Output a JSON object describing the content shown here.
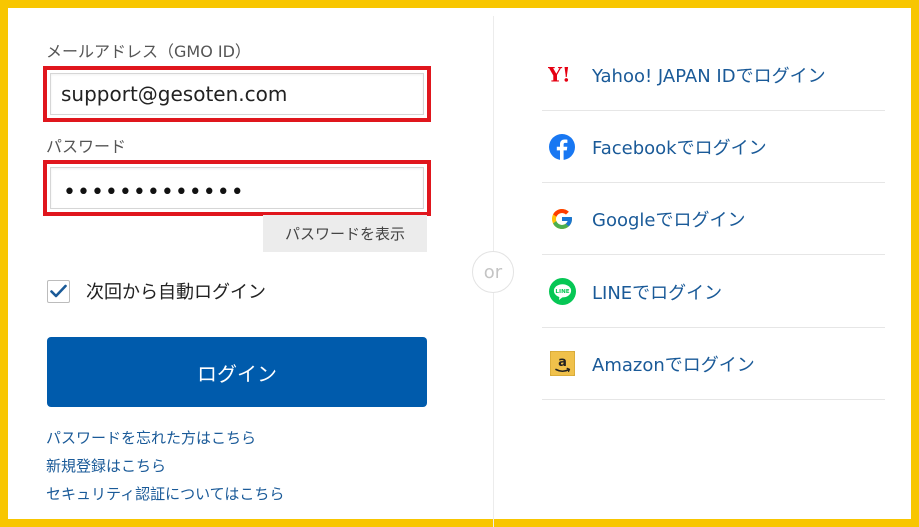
{
  "email": {
    "label": "メールアドレス（GMO ID）",
    "value": "support@gesoten.com"
  },
  "password": {
    "label": "パスワード",
    "masked_value": "•••••••••••••",
    "show_button": "パスワードを表示"
  },
  "remember": {
    "label": "次回から自動ログイン",
    "checked": true
  },
  "login_button": "ログイン",
  "links": {
    "forgot_password": "パスワードを忘れた方はこちら",
    "register": "新規登録はこちら",
    "security": "セキュリティ認証についてはこちら"
  },
  "separator": "or",
  "social": [
    {
      "icon": "yahoo-japan-icon",
      "label": "Yahoo! JAPAN IDでログイン"
    },
    {
      "icon": "facebook-icon",
      "label": "Facebookでログイン"
    },
    {
      "icon": "google-icon",
      "label": "Googleでログイン"
    },
    {
      "icon": "line-icon",
      "label": "LINEでログイン"
    },
    {
      "icon": "amazon-icon",
      "label": "Amazonでログイン"
    }
  ],
  "colors": {
    "frame": "#f8c600",
    "highlight": "#e0161d",
    "primary": "#005bac",
    "link": "#1a5a98"
  }
}
